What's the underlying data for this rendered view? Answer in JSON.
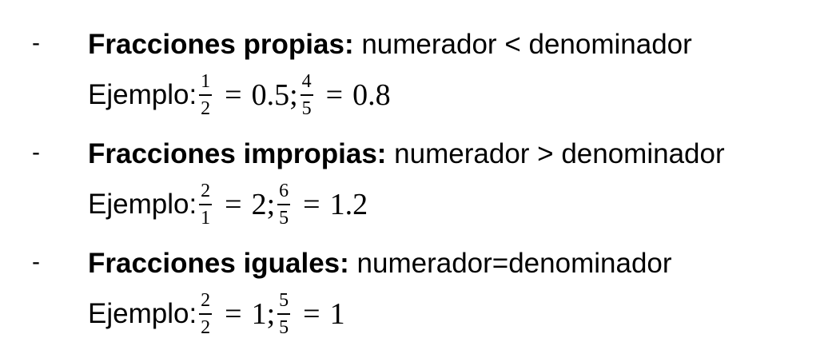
{
  "bullet_marker": "-",
  "example_label": "Ejemplo:",
  "equals_sign": "=",
  "separator": ";",
  "items": [
    {
      "term": "Fracciones propias:",
      "definition": " numerador < denominador",
      "example": {
        "a_num": "1",
        "a_den": "2",
        "a_val": "0.5",
        "b_num": "4",
        "b_den": "5",
        "b_val": "0.8"
      }
    },
    {
      "term": "Fracciones impropias:",
      "definition": " numerador > denominador",
      "example": {
        "a_num": "2",
        "a_den": "1",
        "a_val": "2",
        "b_num": "6",
        "b_den": "5",
        "b_val": "1.2"
      }
    },
    {
      "term": "Fracciones iguales:",
      "definition": " numerador=denominador",
      "example": {
        "a_num": "2",
        "a_den": "2",
        "a_val": "1",
        "b_num": "5",
        "b_den": "5",
        "b_val": "1"
      }
    }
  ]
}
